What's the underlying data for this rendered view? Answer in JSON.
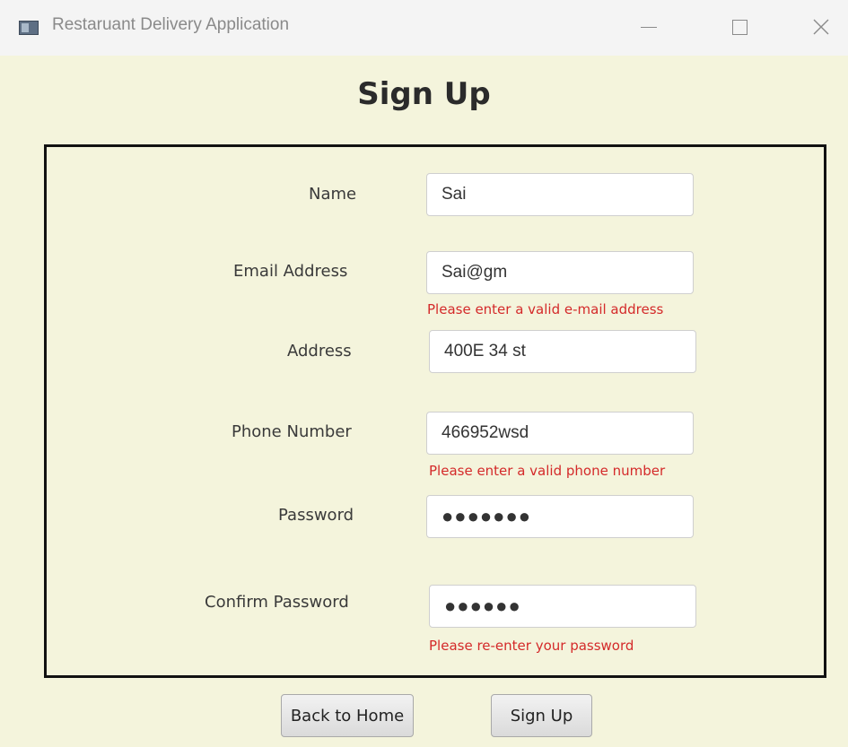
{
  "window": {
    "title": "Restaruant Delivery Application",
    "minimize_icon": "minimize-icon",
    "maximize_icon": "maximize-icon",
    "close_icon": "close-icon"
  },
  "page": {
    "heading": "Sign Up"
  },
  "form": {
    "name": {
      "label": "Name",
      "value": "Sai"
    },
    "email": {
      "label": "Email Address",
      "value": "Sai@gm",
      "error": "Please enter a valid e-mail address"
    },
    "address": {
      "label": "Address",
      "value": "400E 34 st"
    },
    "phone": {
      "label": "Phone Number",
      "value": "466952wsd",
      "error": "Please enter a valid phone number"
    },
    "password": {
      "label": "Password",
      "value": "●●●●●●●"
    },
    "confirm_password": {
      "label": "Confirm Password",
      "value": "●●●●●●",
      "error": "Please re-enter your password"
    }
  },
  "buttons": {
    "back": "Back to Home",
    "signup": "Sign Up"
  },
  "colors": {
    "background": "#f4f4dc",
    "error": "#d42a2a",
    "border": "#111111"
  }
}
